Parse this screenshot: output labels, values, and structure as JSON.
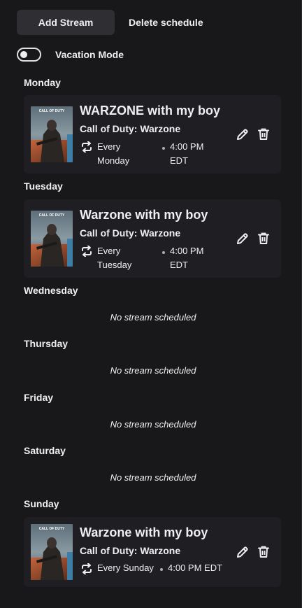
{
  "toolbar": {
    "add_label": "Add Stream",
    "delete_label": "Delete schedule"
  },
  "vacation": {
    "label": "Vacation Mode",
    "enabled": false
  },
  "days": {
    "monday": {
      "label": "Monday",
      "stream": {
        "title": "WARZONE with my boy",
        "game": "Call of Duty: Warzone",
        "recurrence_line1": "Every",
        "recurrence_line2": "Monday",
        "time_line1": "4:00 PM",
        "time_line2": "EDT"
      }
    },
    "tuesday": {
      "label": "Tuesday",
      "stream": {
        "title": "Warzone with my boy",
        "game": "Call of Duty: Warzone",
        "recurrence_line1": "Every",
        "recurrence_line2": "Tuesday",
        "time_line1": "4:00 PM",
        "time_line2": "EDT"
      }
    },
    "wednesday": {
      "label": "Wednesday",
      "empty_text": "No stream scheduled"
    },
    "thursday": {
      "label": "Thursday",
      "empty_text": "No stream scheduled"
    },
    "friday": {
      "label": "Friday",
      "empty_text": "No stream scheduled"
    },
    "saturday": {
      "label": "Saturday",
      "empty_text": "No stream scheduled"
    },
    "sunday": {
      "label": "Sunday",
      "stream": {
        "title": "Warzone with my boy",
        "game": "Call of Duty: Warzone",
        "recurrence": "Every Sunday",
        "time": "4:00 PM EDT"
      }
    }
  },
  "icons": {
    "repeat": "repeat-icon",
    "edit": "pencil-icon",
    "delete": "trash-icon",
    "thumbnail": "game-cover-thumbnail"
  },
  "colors": {
    "background": "#18181b",
    "card": "#1f1f23",
    "button": "#2e2e33",
    "text": "#efeff1",
    "muted": "#adadb8"
  },
  "thumbnail_logo_text": "CALL OF DUTY"
}
